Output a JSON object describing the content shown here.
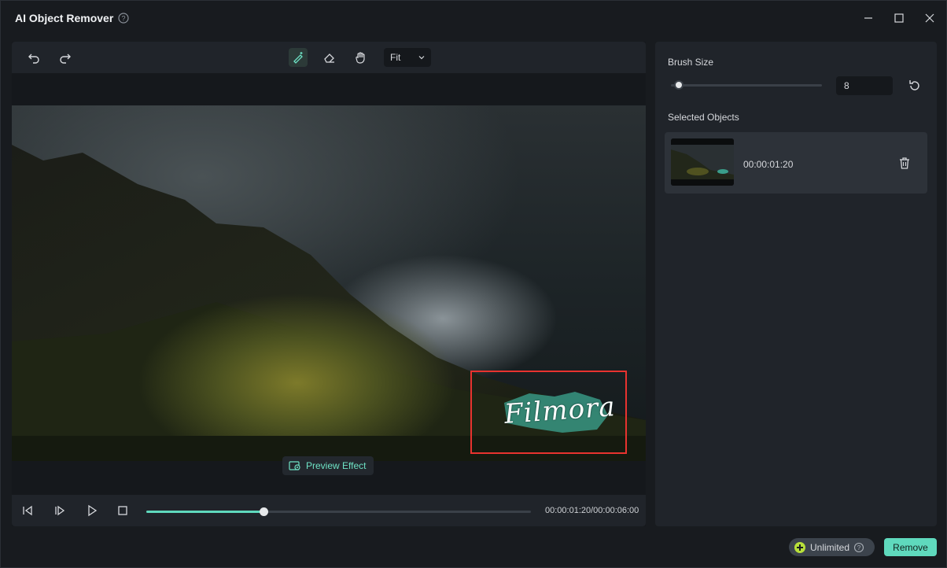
{
  "window": {
    "title": "AI Object Remover"
  },
  "toolbar": {
    "fit_label": "Fit"
  },
  "canvas": {
    "watermark": "Filmora",
    "preview_label": "Preview Effect"
  },
  "player": {
    "timecode": "00:00:01:20/00:00:06:00",
    "progress": 0.305
  },
  "side": {
    "brush_size_label": "Brush Size",
    "brush_size_value": "8",
    "brush_fraction": 0.05,
    "selected_objects_label": "Selected Objects",
    "objects": [
      {
        "time": "00:00:01:20"
      }
    ]
  },
  "footer": {
    "unlimited_label": "Unlimited",
    "remove_label": "Remove"
  },
  "colors": {
    "accent": "#5fd9bd",
    "selection": "#e8332f",
    "background": "#181b1f",
    "panel": "#20242a"
  }
}
